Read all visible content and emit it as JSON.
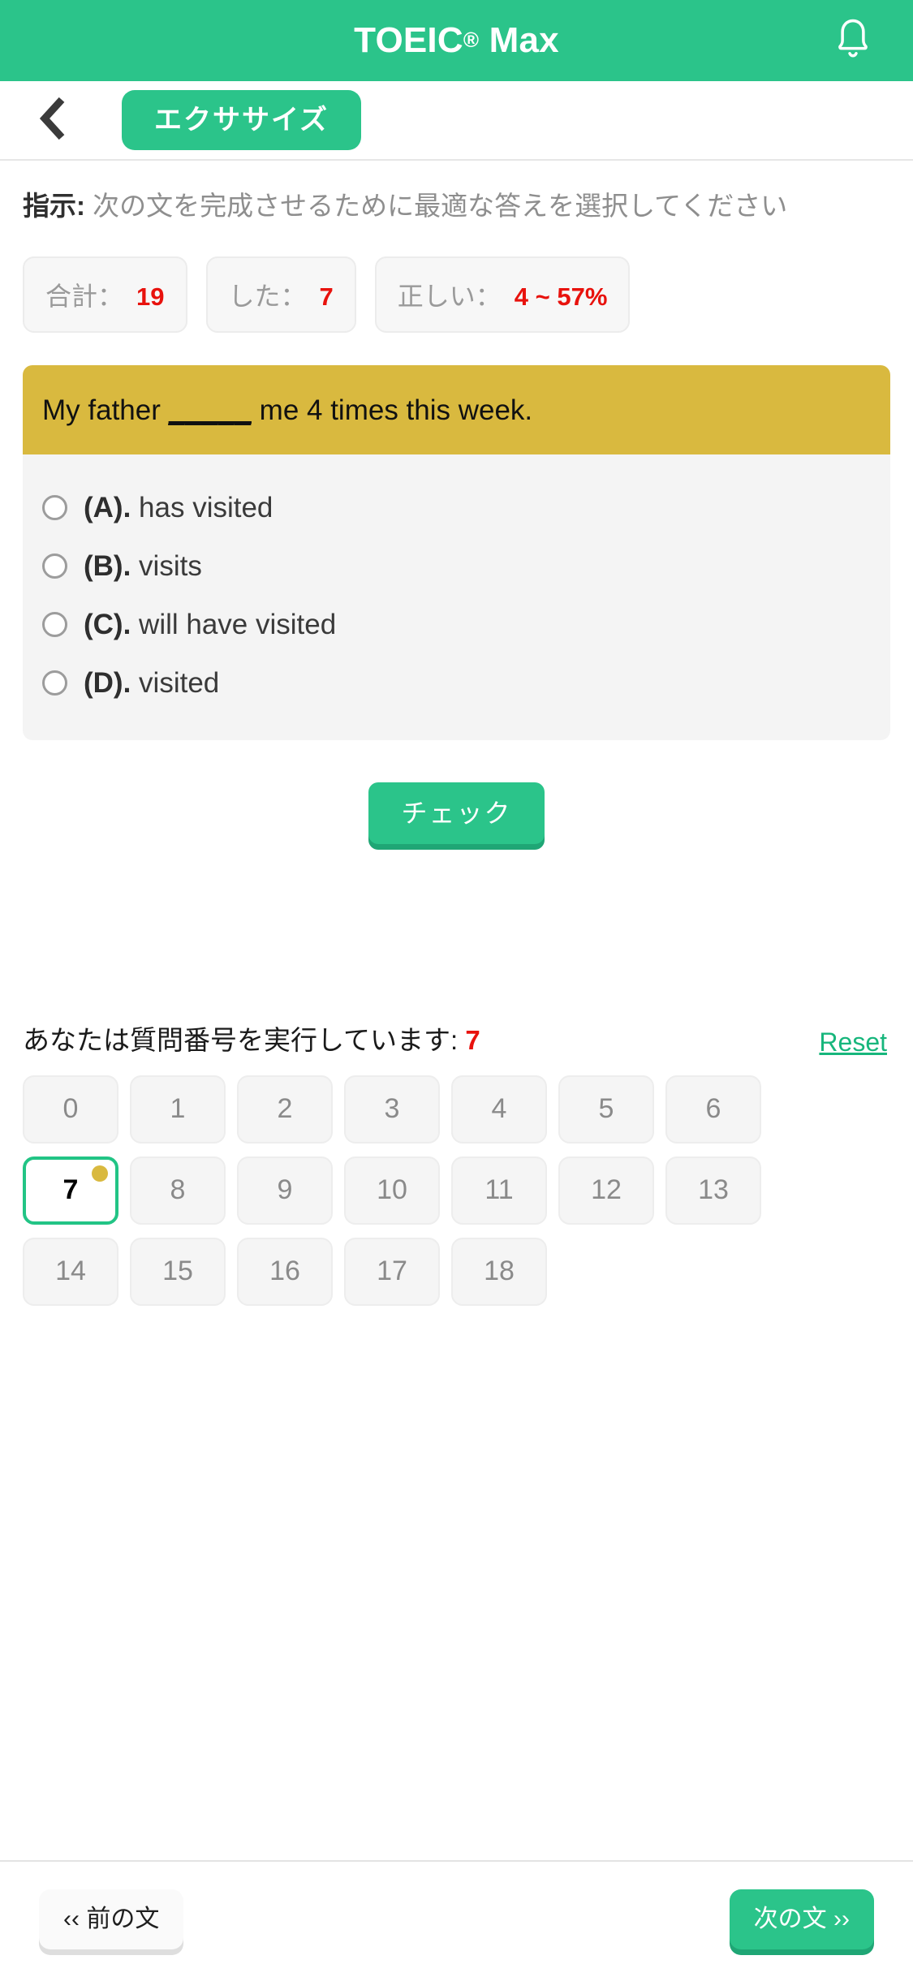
{
  "appbar": {
    "title_main": "TOEIC",
    "title_reg": "®",
    "title_suffix": " Max",
    "bell_icon": "bell-icon"
  },
  "subnav": {
    "back_icon": "chevron-left-icon",
    "exercise_label": "エクササイズ"
  },
  "instructions": {
    "prefix": "指示:",
    "text": " 次の文を完成させるために最適な答えを選択してください"
  },
  "stats": [
    {
      "label": "合計：",
      "value": "19"
    },
    {
      "label": "した：",
      "value": "7"
    },
    {
      "label": "正しい：",
      "value": "4 ~ 57%"
    }
  ],
  "question": {
    "before_blank": "My father ",
    "blank": "_____",
    "after_blank": " me 4 times this week.",
    "options": [
      {
        "letter": "(A).",
        "text": " has visited"
      },
      {
        "letter": "(B).",
        "text": " visits"
      },
      {
        "letter": "(C).",
        "text": " will have visited"
      },
      {
        "letter": "(D).",
        "text": " visited"
      }
    ]
  },
  "check_button": {
    "label": "チェック"
  },
  "progress": {
    "text": "あなたは質問番号を実行しています: ",
    "current": "7",
    "reset_label": "Reset"
  },
  "number_grid": {
    "cells": [
      {
        "n": "0",
        "active": false,
        "dot": false
      },
      {
        "n": "1",
        "active": false,
        "dot": false
      },
      {
        "n": "2",
        "active": false,
        "dot": false
      },
      {
        "n": "3",
        "active": false,
        "dot": false
      },
      {
        "n": "4",
        "active": false,
        "dot": false
      },
      {
        "n": "5",
        "active": false,
        "dot": false
      },
      {
        "n": "6",
        "active": false,
        "dot": false
      },
      {
        "n": "7",
        "active": true,
        "dot": true
      },
      {
        "n": "8",
        "active": false,
        "dot": false
      },
      {
        "n": "9",
        "active": false,
        "dot": false
      },
      {
        "n": "10",
        "active": false,
        "dot": false
      },
      {
        "n": "11",
        "active": false,
        "dot": false
      },
      {
        "n": "12",
        "active": false,
        "dot": false
      },
      {
        "n": "13",
        "active": false,
        "dot": false
      },
      {
        "n": "14",
        "active": false,
        "dot": false
      },
      {
        "n": "15",
        "active": false,
        "dot": false
      },
      {
        "n": "16",
        "active": false,
        "dot": false
      },
      {
        "n": "17",
        "active": false,
        "dot": false
      },
      {
        "n": "18",
        "active": false,
        "dot": false
      }
    ]
  },
  "bottombar": {
    "prev_label": "‹‹ 前の文",
    "next_label": "次の文 ››"
  },
  "colors": {
    "brand_green": "#2bc48a",
    "brand_green_dark": "#1fa675",
    "accent_gold": "#d9b93f",
    "danger_red": "#e8120d",
    "panel_grey": "#f4f4f4",
    "link_green": "#17b67c"
  }
}
